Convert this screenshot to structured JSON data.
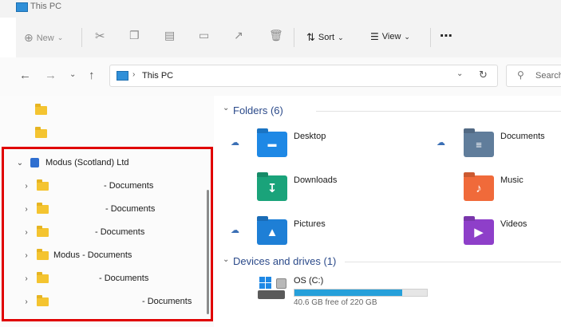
{
  "window": {
    "title": "This PC"
  },
  "toolbar": {
    "new_label": "New",
    "sort_label": "Sort",
    "view_label": "View",
    "more_label": "⋯"
  },
  "address": {
    "path": "This PC",
    "search_placeholder": "Search"
  },
  "sidebar": {
    "org_label": "Modus (Scotland) Ltd",
    "items": [
      {
        "label": "- Documents"
      },
      {
        "label": "- Documents"
      },
      {
        "label": "- Documents"
      },
      {
        "label": "Modus - Documents"
      },
      {
        "label": "- Documents"
      },
      {
        "label": "- Documents"
      }
    ]
  },
  "main": {
    "folders_header": "Folders (6)",
    "folders": [
      {
        "name": "Desktop",
        "icon": "desktop-folder-icon",
        "color": "#1e88e5",
        "cloud": true
      },
      {
        "name": "Documents",
        "icon": "documents-folder-icon",
        "color": "#607d9b",
        "cloud": true
      },
      {
        "name": "Downloads",
        "icon": "downloads-folder-icon",
        "color": "#1aa37a",
        "cloud": false
      },
      {
        "name": "Music",
        "icon": "music-folder-icon",
        "color": "#f06a3a",
        "cloud": false
      },
      {
        "name": "Pictures",
        "icon": "pictures-folder-icon",
        "color": "#1e7fd6",
        "cloud": true
      },
      {
        "name": "Videos",
        "icon": "videos-folder-icon",
        "color": "#8e3fc9",
        "cloud": false
      }
    ],
    "drives_header": "Devices and drives (1)",
    "drive": {
      "name": "OS (C:)",
      "free_text": "40.6 GB free of 220 GB",
      "used_fraction": 0.8155
    }
  },
  "colors": {
    "highlight": "#e00000",
    "accent": "#26a0da"
  }
}
